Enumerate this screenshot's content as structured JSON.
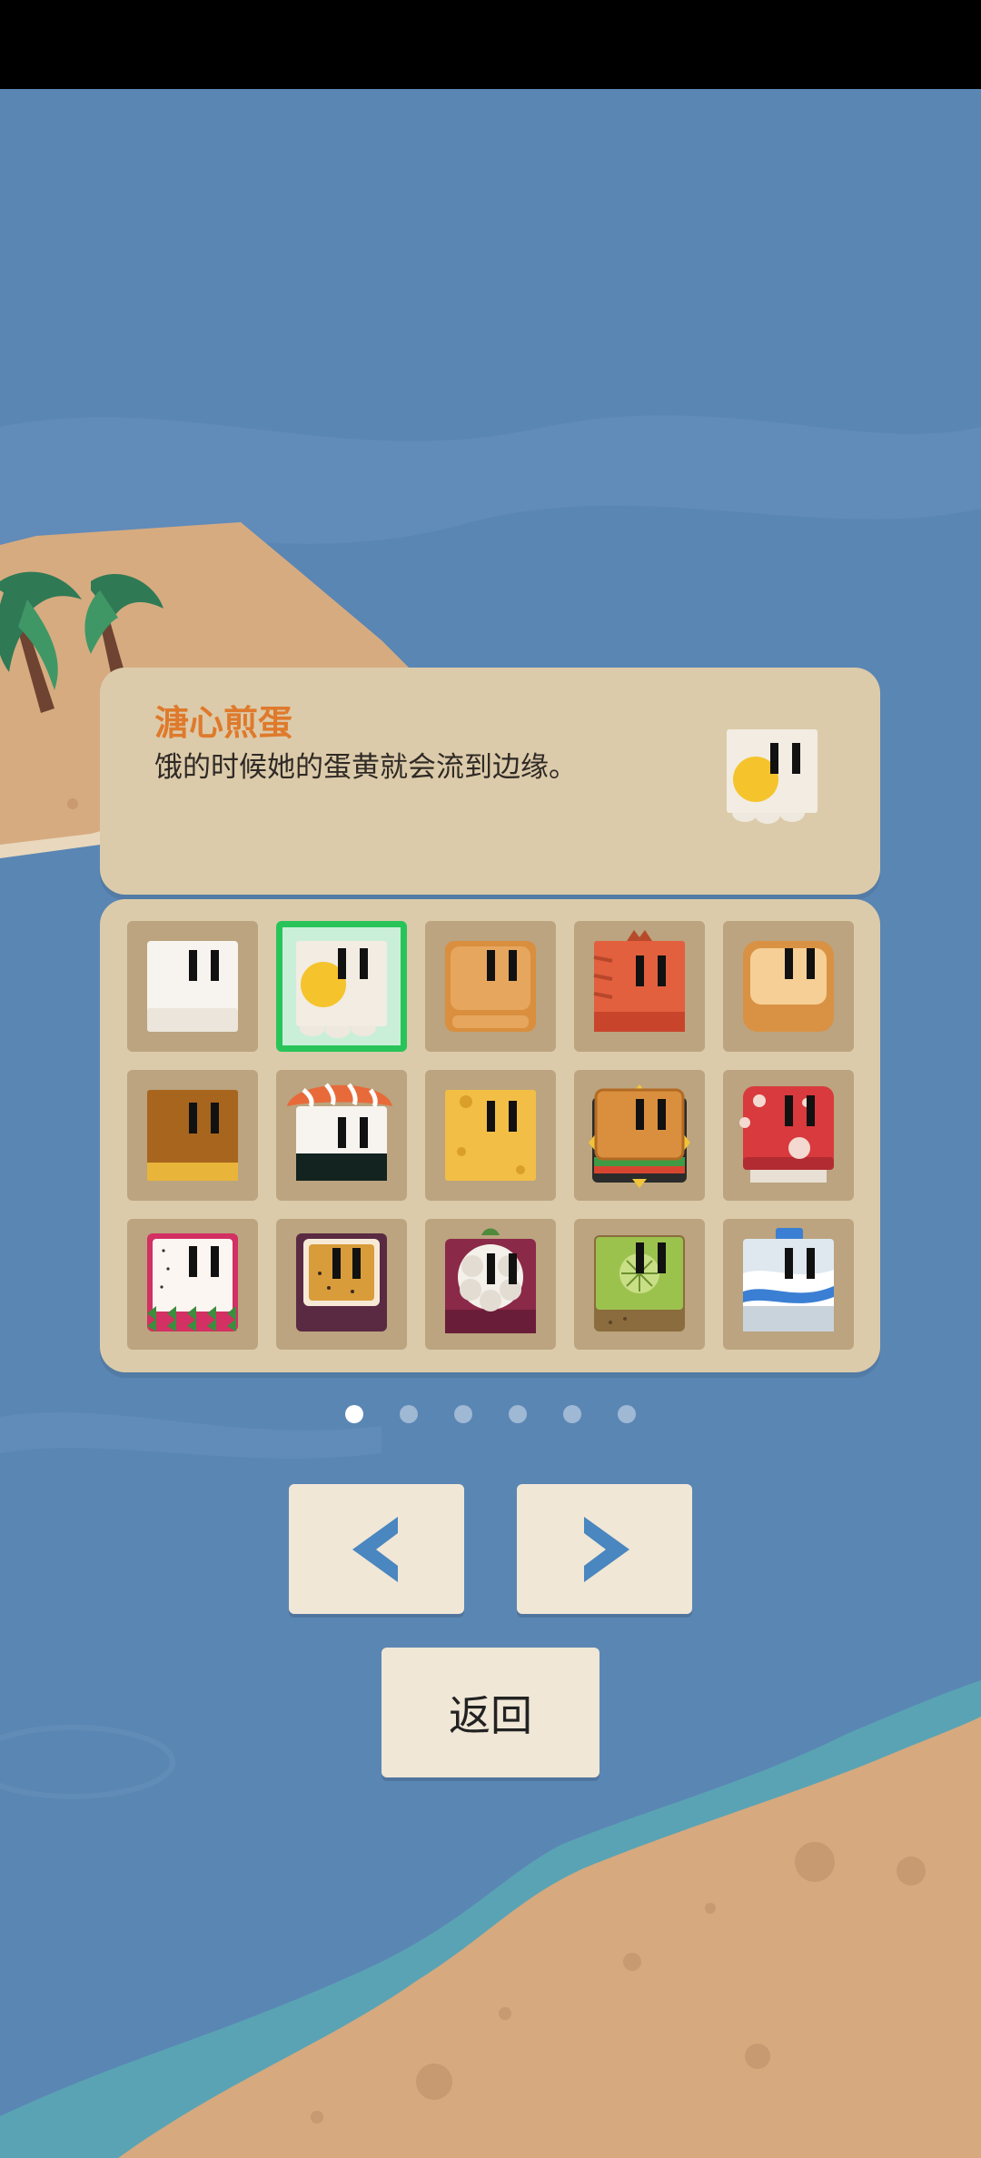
{
  "info": {
    "title": "溏心煎蛋",
    "description": "饿的时候她的蛋黄就会流到边缘。"
  },
  "grid": {
    "selected_index": 1,
    "items": [
      {
        "name": "plain-block"
      },
      {
        "name": "fried-egg-block"
      },
      {
        "name": "bread-block"
      },
      {
        "name": "salmon-block"
      },
      {
        "name": "toast-block"
      },
      {
        "name": "chocolate-cake-block"
      },
      {
        "name": "salmon-sushi-block"
      },
      {
        "name": "cheese-block"
      },
      {
        "name": "sandwich-block"
      },
      {
        "name": "mushroom-block"
      },
      {
        "name": "dragon-fruit-block"
      },
      {
        "name": "passion-fruit-block"
      },
      {
        "name": "mangosteen-block"
      },
      {
        "name": "kiwi-block"
      },
      {
        "name": "milk-bottle-block"
      }
    ]
  },
  "pager": {
    "total": 6,
    "current": 1
  },
  "buttons": {
    "prev_icon": "chevron-left-icon",
    "next_icon": "chevron-right-icon",
    "back_label": "返回"
  },
  "colors": {
    "ocean": "#5a86b4",
    "sand": "#d6a97f",
    "panel": "#dccbaa",
    "slot": "#bba47f",
    "selected": "#28c45a",
    "title": "#df7a2c"
  }
}
